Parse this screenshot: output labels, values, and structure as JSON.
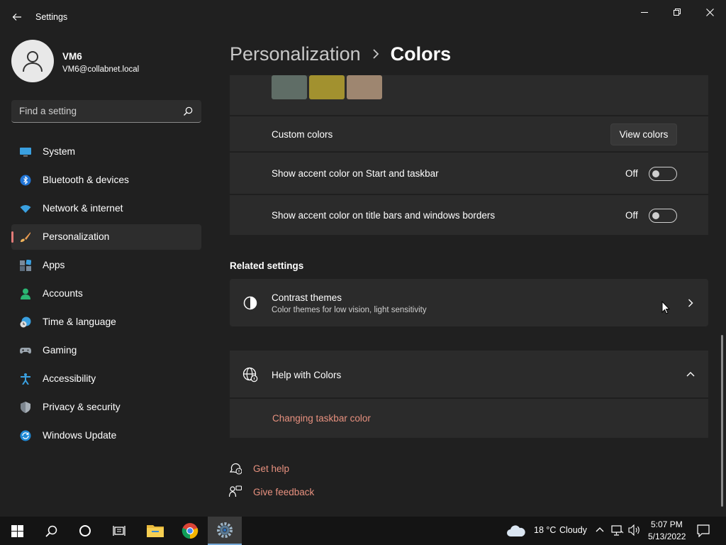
{
  "app": {
    "title": "Settings"
  },
  "profile": {
    "name": "VM6",
    "email": "VM6@collabnet.local"
  },
  "search": {
    "placeholder": "Find a setting"
  },
  "sidebar": {
    "items": [
      {
        "label": "System",
        "icon": "monitor-icon"
      },
      {
        "label": "Bluetooth & devices",
        "icon": "bluetooth-icon"
      },
      {
        "label": "Network & internet",
        "icon": "wifi-icon"
      },
      {
        "label": "Personalization",
        "icon": "brush-icon",
        "selected": true
      },
      {
        "label": "Apps",
        "icon": "apps-icon"
      },
      {
        "label": "Accounts",
        "icon": "person-icon"
      },
      {
        "label": "Time & language",
        "icon": "clock-globe-icon"
      },
      {
        "label": "Gaming",
        "icon": "gamepad-icon"
      },
      {
        "label": "Accessibility",
        "icon": "accessibility-icon"
      },
      {
        "label": "Privacy & security",
        "icon": "shield-icon"
      },
      {
        "label": "Windows Update",
        "icon": "update-icon"
      }
    ]
  },
  "breadcrumb": {
    "parent": "Personalization",
    "current": "Colors"
  },
  "colors": {
    "swatches": [
      "#5f6d66",
      "#a2912f",
      "#9e8670"
    ],
    "custom_colors_label": "Custom colors",
    "view_colors_button": "View colors",
    "accent_start_label": "Show accent color on Start and taskbar",
    "accent_start_state": "Off",
    "accent_titlebar_label": "Show accent color on title bars and windows borders",
    "accent_titlebar_state": "Off"
  },
  "related": {
    "heading": "Related settings",
    "contrast_title": "Contrast themes",
    "contrast_subtitle": "Color themes for low vision, light sensitivity"
  },
  "help": {
    "title": "Help with Colors",
    "link": "Changing taskbar color"
  },
  "footer": {
    "get_help": "Get help",
    "give_feedback": "Give feedback"
  },
  "taskbar": {
    "weather_temp": "18 °C",
    "weather_text": "Cloudy",
    "time": "5:07 PM",
    "date": "5/13/2022"
  },
  "theme": {
    "accent": "#e27b78",
    "link": "#e8917f",
    "background": "#202020",
    "card": "#2b2b2b"
  }
}
